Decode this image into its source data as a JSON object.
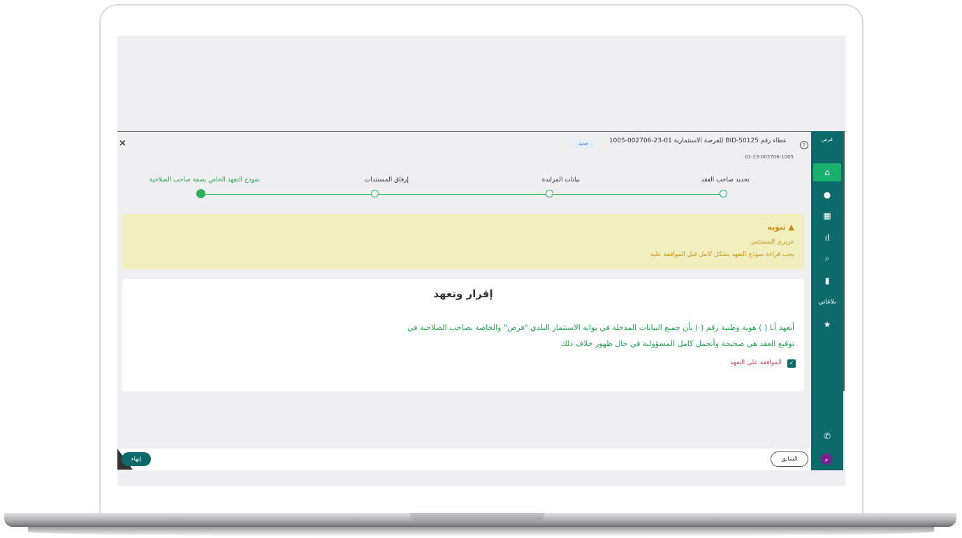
{
  "header": {
    "title": "عطاء رقم BID-50125 للفرصة الاستثمارية 01-23-002706-1005",
    "badge": "جديد",
    "subtitle": "01-23-002706-1005",
    "close_icon": "×"
  },
  "steps": [
    {
      "label": "تحديد صاحب العقد",
      "state": "done"
    },
    {
      "label": "بيانات المزايدة",
      "state": "done"
    },
    {
      "label": "إرفاق المستندات",
      "state": "done"
    },
    {
      "label": "نموذج التعهد الخاص بصفة صاحب الصلاحية",
      "state": "current"
    }
  ],
  "warning": {
    "title": "تنويه",
    "line1": "عزيزي المستثمر،",
    "line2": "يجب قراءة نموذج التعهد بشكل كامل قبل الموافقة عليه"
  },
  "declaration": {
    "title": "إقرار وتعهد",
    "line1": "أتعهد أنا (                               ) هوية وطنية رقم (               ) بأن جميع البيانات المدخلة في بوابة الاستثمار البلدي \"فرص\" والخاصة بصاحب الصلاحية في",
    "line2": "توقيع العقد هي صحيحة وأتحمل كامل المسؤولية في حال ظهور خلاف ذلك",
    "checkbox_label": "الموافقة على التعهد",
    "checked": true
  },
  "footer": {
    "prev_label": "السابق",
    "finish_label": "إنهاء"
  },
  "sidebar": {
    "logo_text": "فرص",
    "items": [
      {
        "icon": "home-icon",
        "glyph": "⌂"
      },
      {
        "icon": "globe-icon",
        "glyph": "●"
      },
      {
        "icon": "grid-icon",
        "glyph": "▦"
      },
      {
        "icon": "bar-chart-icon",
        "glyph": "ıl"
      },
      {
        "icon": "search-icon",
        "glyph": "⌕"
      },
      {
        "icon": "document-icon",
        "glyph": "▮"
      },
      {
        "icon": "megaphone-label",
        "glyph": "بلاغاتي"
      },
      {
        "icon": "star-icon",
        "glyph": "★"
      },
      {
        "icon": "phone-icon",
        "glyph": "✆"
      }
    ],
    "avatar_text": "م"
  },
  "colors": {
    "sidebar": "#0c6a6a",
    "accent_green": "#28b25a",
    "warning_bg": "#f2efbf",
    "warning_text": "#c9951c"
  }
}
